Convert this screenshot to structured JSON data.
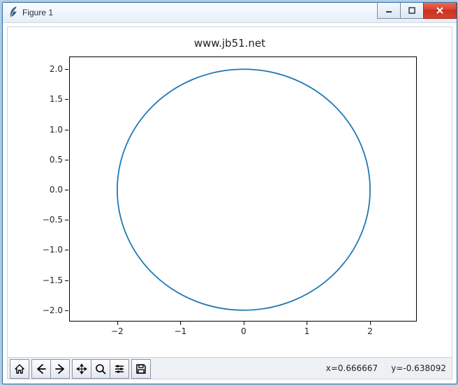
{
  "window": {
    "title": "Figure 1"
  },
  "chart_data": {
    "type": "line",
    "title": "www.jb51.net",
    "xlabel": "",
    "ylabel": "",
    "xlim": [
      -2.75,
      2.75
    ],
    "ylim": [
      -2.2,
      2.2
    ],
    "xticks": [
      -2,
      -1,
      0,
      1,
      2
    ],
    "yticks": [
      -2.0,
      -1.5,
      -1.0,
      -0.5,
      0.0,
      0.5,
      1.0,
      1.5,
      2.0
    ],
    "xtick_labels": [
      "−2",
      "−1",
      "0",
      "1",
      "2"
    ],
    "ytick_labels": [
      "−2.0",
      "−1.5",
      "−1.0",
      "−0.5",
      "0.0",
      "0.5",
      "1.0",
      "1.5",
      "2.0"
    ],
    "series": [
      {
        "name": "circle",
        "shape": "circle",
        "center": [
          0,
          0
        ],
        "radius": 2,
        "color": "#1f77b4"
      }
    ]
  },
  "toolbar": {
    "items": [
      "home",
      "back",
      "forward",
      "pan",
      "zoom",
      "configure",
      "save"
    ]
  },
  "status": {
    "x_label": "x=",
    "x_value": "0.666667",
    "y_label": "y=",
    "y_value": "-0.638092"
  }
}
